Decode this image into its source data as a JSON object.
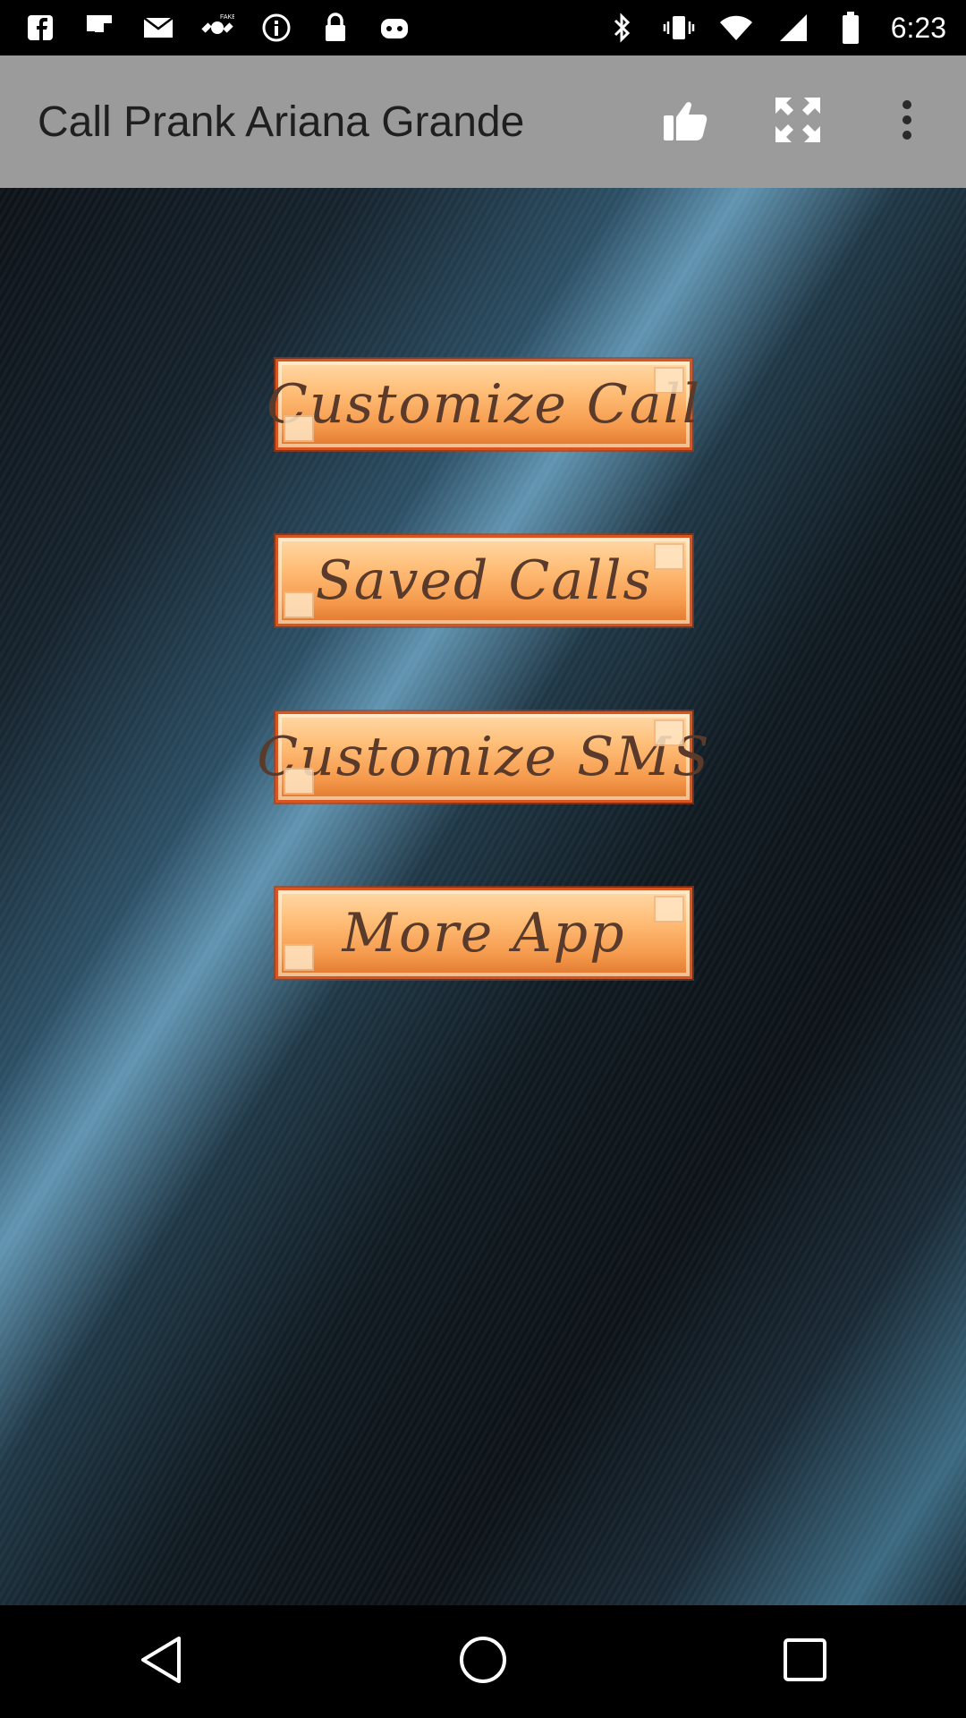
{
  "status_bar": {
    "time": "6:23",
    "left_icons": [
      "fb-messenger-icon",
      "flipboard-icon",
      "email-icon",
      "fake-gps-icon",
      "info-icon",
      "lock-icon",
      "game-controller-icon"
    ],
    "right_icons": [
      "bluetooth-icon",
      "vibrate-icon",
      "wifi-icon",
      "signal-icon",
      "battery-icon"
    ]
  },
  "app_bar": {
    "title": "Call Prank Ariana Grande",
    "actions": [
      "like-icon",
      "fullscreen-icon",
      "overflow-menu-icon"
    ]
  },
  "menu": {
    "customize_call": "Customize Call",
    "saved_calls": "Saved Calls",
    "customize_sms": "Customize SMS",
    "more_app": "More App"
  },
  "nav_bar": {
    "buttons": [
      "back-icon",
      "home-icon",
      "recents-icon"
    ]
  },
  "colors": {
    "app_bar": "#9b9b9b",
    "button_fill": "#f59a4c",
    "button_border": "#d9541f",
    "button_text": "#5a3a2a"
  }
}
